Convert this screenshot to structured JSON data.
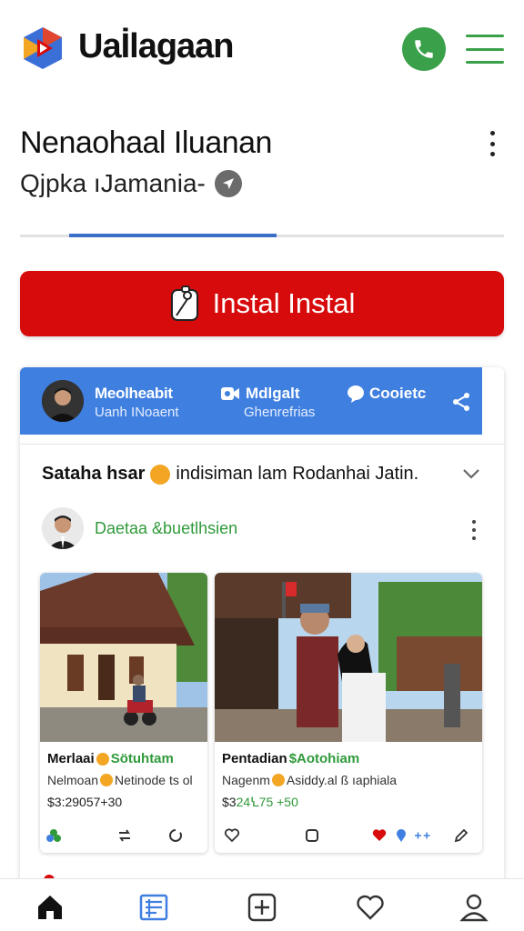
{
  "app": {
    "title": "Uaİlagaan",
    "icons": {
      "logo": "play-logo-icon",
      "call": "phone-icon",
      "menu": "hamburger-menu-icon"
    }
  },
  "header": {
    "title": "Nenaohaal Iluanan",
    "subtitle": "Qjpka ıJamania-",
    "subtitle_icon": "location-icon"
  },
  "install_button": {
    "label": "Instal Instal",
    "icon": "package-icon"
  },
  "card": {
    "header": {
      "name": "Meolheabit",
      "handle": "Uanh INoaent",
      "meta_label": "Mdlgalt",
      "meta_sub": "Ghenrefrias",
      "contact_label": "Cooietc",
      "icons": [
        "video-icon",
        "chat-icon",
        "share-icon"
      ]
    },
    "post_title": {
      "bold": "Sataha hsar",
      "rest": "indisiman lam Rodanhai Jatin."
    },
    "author_name": "Daetaa &buetlhsien",
    "listings": [
      {
        "title_a": "Merlaai",
        "title_b": "Sötuhtam",
        "desc_a": "Nelmoan",
        "desc_b": "Netinode ts ol",
        "price": "$3:29057+30"
      },
      {
        "title_a": "Pentadian",
        "title_b": "$Aotohiam",
        "desc_a": "Nagenm",
        "desc_b": "Asiddy.al ß ıaphiala",
        "price_a": "$3",
        "price_b": "24Ꝇ75 +50"
      }
    ]
  },
  "bottom_nav": [
    "home-icon",
    "feed-icon",
    "add-icon",
    "heart-icon",
    "profile-icon"
  ],
  "colors": {
    "accent_green": "#2f9a3a",
    "install_red": "#d70b0b",
    "header_blue": "#3f7fe0",
    "tab_blue": "#3c6fc8"
  }
}
